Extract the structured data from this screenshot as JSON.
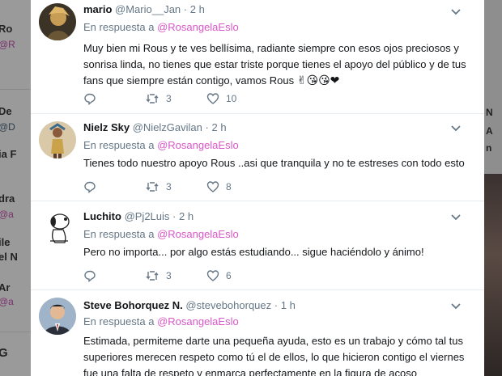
{
  "background_left": {
    "fragments": [
      "Ro",
      "@R",
      "De",
      "@D",
      "ia F",
      "dra",
      "@a",
      "ile",
      "el N",
      "Ar",
      "@a",
      "G"
    ]
  },
  "background_right": {
    "fragments": [
      "N",
      "A",
      "n"
    ]
  },
  "tweets": [
    {
      "name": "mario",
      "handle": "@Mario__Jan",
      "dot": "·",
      "time": "2 h",
      "reply_prefix": "En respuesta a ",
      "reply_mention": "@RosangelaEslo",
      "text": "Muy bien mi Rous y te ves bellísima, radiante siempre con esos ojos preciosos y sonrisa linda, no tienes que estar triste porque tienes el apoyo del público y de tus fans que siempre están contigo, vamos Rous",
      "emojis": "✌😘😘❤",
      "retweets": "3",
      "likes": "10"
    },
    {
      "name": "Nielz Sky",
      "handle": "@NielzGavilan",
      "dot": "·",
      "time": "2 h",
      "reply_prefix": "En respuesta a ",
      "reply_mention": "@RosangelaEslo",
      "text": "Tienes todo nuestro apoyo Rous ..asi que tranquila y no te estreses con todo esto",
      "retweets": "3",
      "likes": "8"
    },
    {
      "name": "Luchito",
      "handle": "@Pj2Luis",
      "dot": "·",
      "time": "2 h",
      "reply_prefix": "En respuesta a ",
      "reply_mention": "@RosangelaEslo",
      "text": "Pero no importa... por algo estás estudiando... sigue haciéndolo y ánimo!",
      "retweets": "3",
      "likes": "6"
    },
    {
      "name": "Steve Bohorquez N.",
      "handle": "@stevebohorquez",
      "dot": "·",
      "time": "1 h",
      "reply_prefix": "En respuesta a ",
      "reply_mention": "@RosangelaEslo",
      "text": "Estimada, permiteme darte una pequeña ayuda, esto es un trabajo y cómo tal tus superiores merecen respeto como tú el de ellos, lo que hicieron contigo el viernes fue una falta de respeto y enmarca perfectamente en la figura de acoso"
    }
  ],
  "colors": {
    "mention": "#d957c8",
    "muted": "#657786",
    "text": "#14171a",
    "overlay": "#7f7f7f"
  }
}
